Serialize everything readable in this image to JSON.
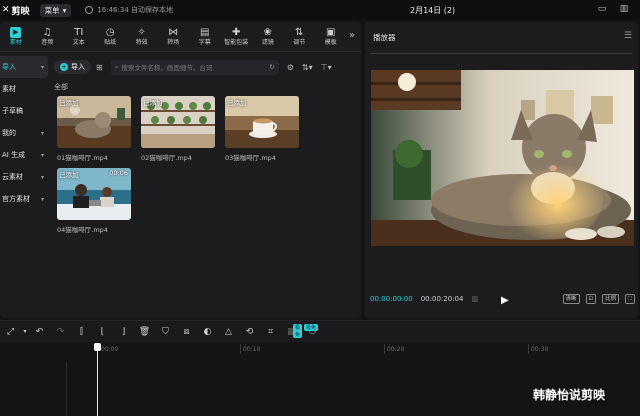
{
  "titlebar": {
    "app_name": "剪映",
    "menu_label": "菜单",
    "save_status": "16:46:34 自动保存本地",
    "doc_title": "2月14日 (2)"
  },
  "toolbar": {
    "items": [
      {
        "label": "素材",
        "icon": "media-icon",
        "glyph": "▶"
      },
      {
        "label": "音频",
        "icon": "audio-icon",
        "glyph": "♫"
      },
      {
        "label": "文本",
        "icon": "text-icon",
        "glyph": "TI"
      },
      {
        "label": "贴纸",
        "icon": "sticker-icon",
        "glyph": "◷"
      },
      {
        "label": "特效",
        "icon": "effects-icon",
        "glyph": "✧"
      },
      {
        "label": "转场",
        "icon": "transition-icon",
        "glyph": "⋈"
      },
      {
        "label": "字幕",
        "icon": "caption-icon",
        "glyph": "▤"
      },
      {
        "label": "智能包装",
        "icon": "smart-pack-icon",
        "glyph": "✚"
      },
      {
        "label": "滤镜",
        "icon": "filter-icon",
        "glyph": "❀"
      },
      {
        "label": "调节",
        "icon": "adjust-icon",
        "glyph": "⇅"
      },
      {
        "label": "模板",
        "icon": "template-icon",
        "glyph": "▣"
      }
    ],
    "more": "»"
  },
  "sidebar": {
    "items": [
      {
        "label": "导入",
        "selected": true
      },
      {
        "label": "素材"
      },
      {
        "label": "子草稿"
      },
      {
        "label": "我的"
      },
      {
        "label": "AI 生成"
      },
      {
        "label": "云素材"
      },
      {
        "label": "官方素材"
      }
    ]
  },
  "content": {
    "import_label": "导入",
    "search_placeholder": "搜索文件名称、画面细节、台词",
    "section": "全部",
    "clips": [
      {
        "name": "01猫咖啡厅.mp4",
        "badge": "已添加",
        "duration": ""
      },
      {
        "name": "02猫咖啡厅.mp4",
        "badge": "已添加",
        "duration": ""
      },
      {
        "name": "03猫咖啡厅.mp4",
        "badge": "已添加",
        "duration": ""
      },
      {
        "name": "04猫咖啡厅.mp4",
        "badge": "已添加",
        "duration": "00:06"
      }
    ]
  },
  "player": {
    "title": "播放器",
    "current_time": "00:00:00:00",
    "total_time": "00:00:20:04",
    "buttons": [
      "清晰",
      "⊡",
      "比例",
      "⛶"
    ]
  },
  "timeline": {
    "ticks": [
      "00:00",
      "00:10",
      "00:20",
      "00:30"
    ],
    "tags": [
      "极免",
      "极免"
    ]
  },
  "watermark": "韩静怡说剪映",
  "colors": {
    "accent": "#2fcfd8",
    "background": "#141416",
    "panel": "#1c1c1f"
  }
}
